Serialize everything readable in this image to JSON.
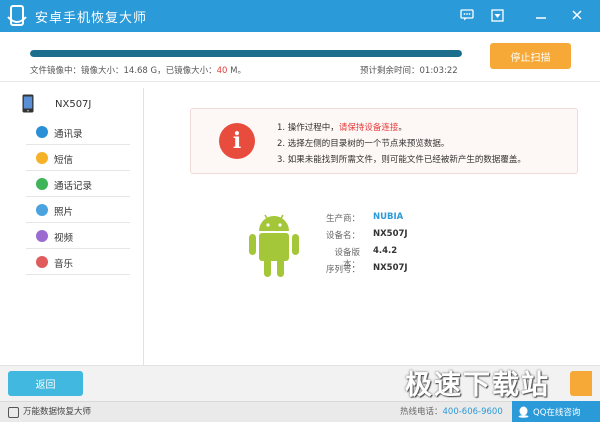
{
  "titlebar": {
    "title": "安卓手机恢复大师",
    "icons": [
      "chat-icon",
      "menu-icon",
      "minimize-icon",
      "close-icon"
    ]
  },
  "scan": {
    "progress_fraction": 1.0,
    "image_label": "文件镜像中：镜像大小：14.68 G，已镜像大小：",
    "imaged_size": "40",
    "imaged_unit": " M。",
    "remaining": "预计剩余时间：01:03:22",
    "stop_button": "停止扫描"
  },
  "sidebar": {
    "device_name": "NX507J",
    "items": [
      {
        "label": "通讯录",
        "icon": "contacts-icon",
        "color": "#2b8fd6"
      },
      {
        "label": "短信",
        "icon": "sms-icon",
        "color": "#f5b226"
      },
      {
        "label": "通话记录",
        "icon": "phone-icon",
        "color": "#3db45a"
      },
      {
        "label": "照片",
        "icon": "photo-icon",
        "color": "#4aa3df"
      },
      {
        "label": "视频",
        "icon": "video-icon",
        "color": "#9b6bd0"
      },
      {
        "label": "音乐",
        "icon": "music-icon",
        "color": "#e05b5b"
      }
    ]
  },
  "notice": {
    "line1_pre": "1. 操作过程中，",
    "line1_red": "请保持设备连接",
    "line1_post": "。",
    "line2": "2. 选择左侧的目录树的一个节点来预览数据。",
    "line3": "3. 如果未能找到所需文件，则可能文件已经被新产生的数据覆盖。"
  },
  "device_info": {
    "rows": [
      {
        "key": "生产商：",
        "value": "NUBIA"
      },
      {
        "key": "设备名：",
        "value": "NX507J"
      },
      {
        "key": "设备版本：",
        "value": "4.4.2"
      },
      {
        "key": "序列号：",
        "value": "NX507J"
      }
    ]
  },
  "footer": {
    "back_button": "返回",
    "watermark": "极速下载站",
    "brand": "万能数据恢复大师",
    "hotline_label": "热线电话：",
    "hotline_number": "400-606-9600",
    "qq_button": "QQ在线咨询"
  },
  "colors": {
    "titlebar": "#2b9ad9",
    "progress": "#1b6e8c",
    "stop_button": "#f7a937",
    "back_button": "#40b8e0",
    "alert_icon": "#e84c3d",
    "android_green": "#a4c639"
  }
}
